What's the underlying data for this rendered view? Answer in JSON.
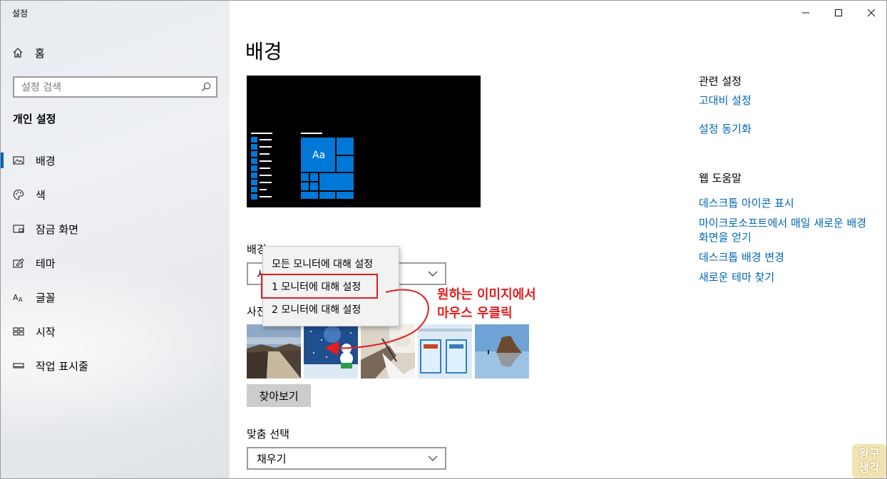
{
  "app_title": "설정",
  "nav": {
    "home_label": "홈",
    "search_placeholder": "설정 검색",
    "section_title": "개인 설정",
    "items": [
      {
        "label": "배경",
        "icon": "picture-icon",
        "active": true
      },
      {
        "label": "색",
        "icon": "palette-icon",
        "active": false
      },
      {
        "label": "잠금 화면",
        "icon": "lock-screen-icon",
        "active": false
      },
      {
        "label": "테마",
        "icon": "theme-brush-icon",
        "active": false
      },
      {
        "label": "글꼴",
        "icon": "font-icon",
        "active": false
      },
      {
        "label": "시작",
        "icon": "start-grid-icon",
        "active": false
      },
      {
        "label": "작업 표시줄",
        "icon": "taskbar-icon",
        "active": false
      }
    ]
  },
  "main": {
    "title": "배경",
    "background_label": "배경",
    "background_value": "사진",
    "preview_tile_text": "Aa",
    "choose_label": "사진 선택",
    "browse_label": "찾아보기",
    "fit_label": "맞춤 선택",
    "fit_value": "채우기"
  },
  "context_menu": {
    "items": [
      "모든 모니터에 대해 설정",
      "1 모니터에 대해 설정",
      "2 모니터에 대해 설정"
    ],
    "highlighted_index": 1
  },
  "annotation": {
    "line1": "원하는 이미지에서",
    "line2": "마우스 우클릭",
    "color": "#e41e1e"
  },
  "related": {
    "heading": "관련 설정",
    "links": [
      "고대비 설정",
      "설정 동기화"
    ]
  },
  "help": {
    "heading": "웹 도움말",
    "links": [
      "데스크톱 아이콘 표시",
      "마이크로소프트에서 매일 새로운 배경 화면을 얻기",
      "데스크톱 배경 변경",
      "새로운 테마 찾기"
    ]
  },
  "watermark": {
    "line1": "왕구",
    "line2": "생각"
  },
  "colors": {
    "accent": "#0066b4",
    "tile_blue": "#0078d7",
    "active_bar": "#0063b1"
  }
}
